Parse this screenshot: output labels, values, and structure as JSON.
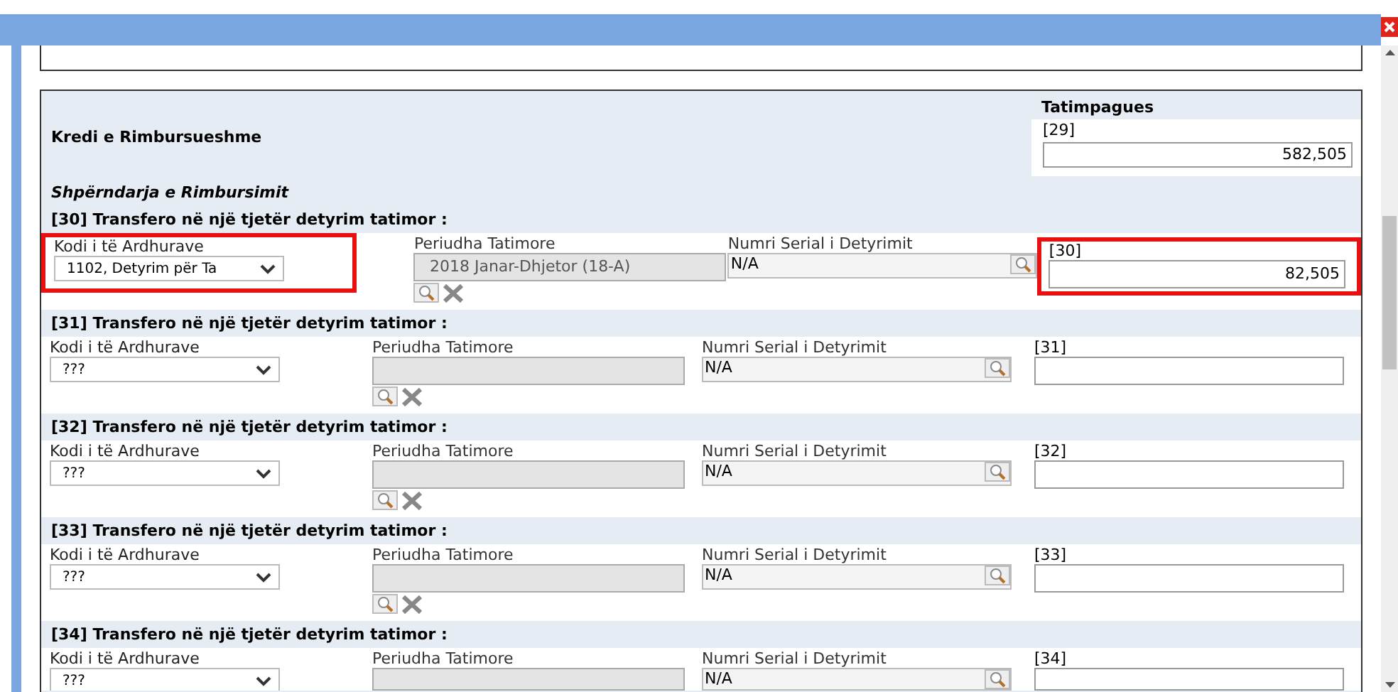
{
  "summary": {
    "column_heading": "Tatimpagues",
    "title": "Kredi e Rimbursueshme",
    "field_label": "[29]",
    "value": "582,505"
  },
  "subtitle": "Shpërndarja e Rimbursimit",
  "sections": [
    {
      "header": "[30] Transfero në një tjetër detyrim tatimor :",
      "code_label": "Kodi i të Ardhurave",
      "code_value": "1102, Detyrim për Ta",
      "period_label": "Periudha Tatimore",
      "period_value": "2018 Janar-Dhjetor (18-A)",
      "serial_label": "Numri Serial i Detyrimit",
      "serial_value": "N/A",
      "amount_label": "[30]",
      "amount_value": "82,505",
      "highlighted": true
    },
    {
      "header": "[31] Transfero në një tjetër detyrim tatimor :",
      "code_label": "Kodi i të Ardhurave",
      "code_value": "???",
      "period_label": "Periudha Tatimore",
      "serial_label": "Numri Serial i Detyrimit",
      "serial_value": "N/A",
      "amount_label": "[31]",
      "highlighted": false
    },
    {
      "header": "[32] Transfero në një tjetër detyrim tatimor :",
      "code_label": "Kodi i të Ardhurave",
      "code_value": "???",
      "period_label": "Periudha Tatimore",
      "serial_label": "Numri Serial i Detyrimit",
      "serial_value": "N/A",
      "amount_label": "[32]",
      "highlighted": false
    },
    {
      "header": "[33] Transfero në një tjetër detyrim tatimor :",
      "code_label": "Kodi i të Ardhurave",
      "code_value": "???",
      "period_label": "Periudha Tatimore",
      "serial_label": "Numri Serial i Detyrimit",
      "serial_value": "N/A",
      "amount_label": "[33]",
      "highlighted": false
    },
    {
      "header": "[34] Transfero në një tjetër detyrim tatimor :",
      "code_label": "Kodi i të Ardhurave",
      "code_value": "???",
      "period_label": "Periudha Tatimore",
      "serial_label": "Numri Serial i Detyrimit",
      "serial_value": "N/A",
      "amount_label": "[34]",
      "highlighted": false
    }
  ]
}
